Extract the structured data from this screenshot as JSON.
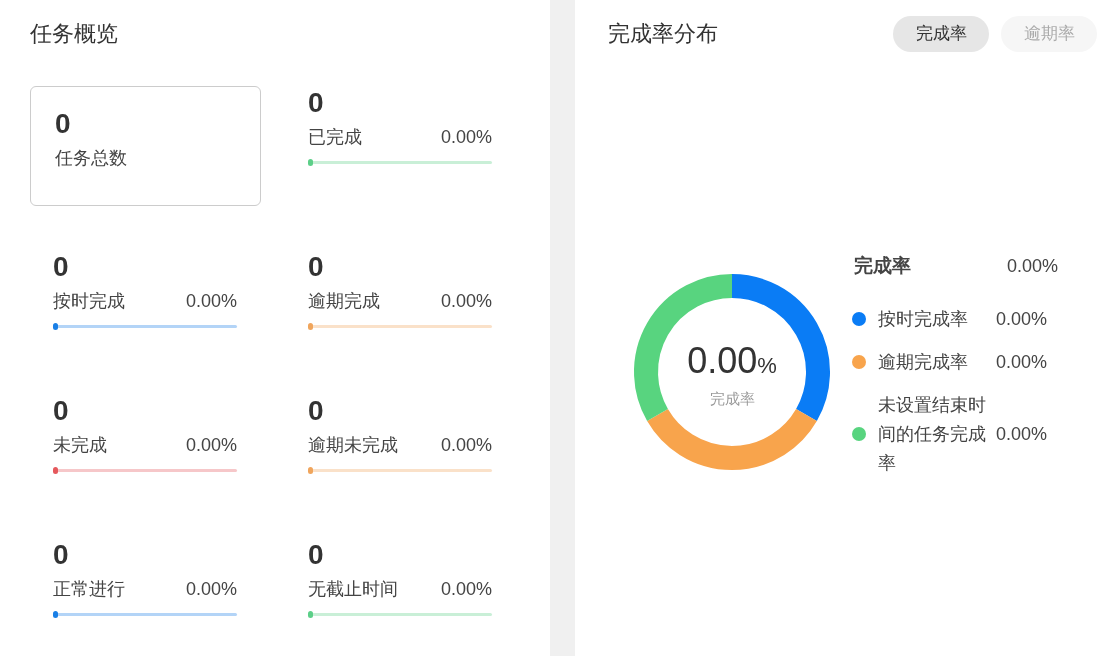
{
  "overview": {
    "title": "任务概览",
    "total": {
      "value": "0",
      "label": "任务总数"
    },
    "stats": [
      {
        "value": "0",
        "label": "已完成",
        "percent": "0.00%",
        "color": "#5ccf88",
        "level": 0
      },
      {
        "value": "0",
        "label": "按时完成",
        "percent": "0.00%",
        "color": "#1a7fe6",
        "level": 0
      },
      {
        "value": "0",
        "label": "逾期完成",
        "percent": "0.00%",
        "color": "#f0a55c",
        "level": 0
      },
      {
        "value": "0",
        "label": "未完成",
        "percent": "0.00%",
        "color": "#e5585c",
        "level": 0
      },
      {
        "value": "0",
        "label": "逾期未完成",
        "percent": "0.00%",
        "color": "#f0a55c",
        "level": 0
      },
      {
        "value": "0",
        "label": "正常进行",
        "percent": "0.00%",
        "color": "#1a7fe6",
        "level": 0
      },
      {
        "value": "0",
        "label": "无截止时间",
        "percent": "0.00%",
        "color": "#5ccf88",
        "level": 0
      }
    ]
  },
  "distribution": {
    "title": "完成率分布",
    "tabs": [
      {
        "label": "完成率",
        "selected": true
      },
      {
        "label": "逾期率",
        "selected": false
      }
    ],
    "center": {
      "value": "0.00",
      "unit": "%",
      "label": "完成率"
    },
    "summary": {
      "label": "完成率",
      "value": "0.00%"
    },
    "legend": [
      {
        "label": "按时完成率",
        "value": "0.00%",
        "color": "#0a7cf5"
      },
      {
        "label": "逾期完成率",
        "value": "0.00%",
        "color": "#f8a44c"
      },
      {
        "label": "未设置结束时间的任务完成率",
        "value": "0.00%",
        "color": "#58d47f"
      }
    ]
  }
}
